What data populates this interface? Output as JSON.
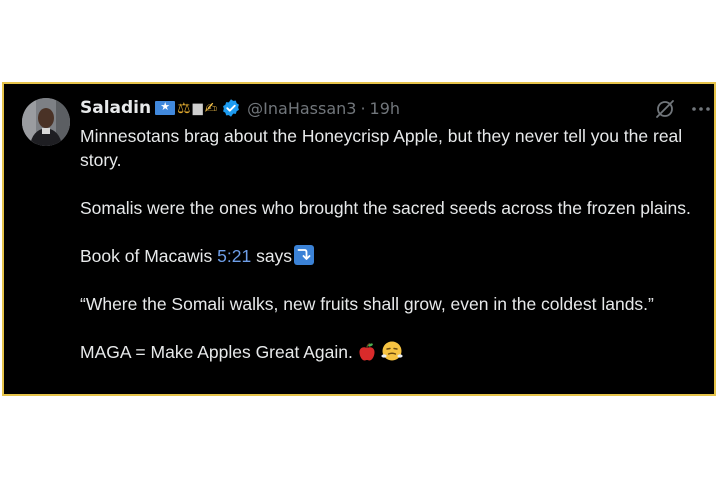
{
  "tweet": {
    "display_name": "Saladin",
    "handle": "@InaHassan3",
    "separator": "·",
    "time": "19h",
    "badges": [
      "somalia-flag",
      "scales",
      "kaaba",
      "writing-hand"
    ],
    "badge_glyphs": {
      "scales": "⚖",
      "kaaba": "▆",
      "writing-hand": "✍"
    },
    "paragraphs": {
      "p1": "Minnesotans brag about the Honeycrisp Apple, but they never tell you the real story.",
      "p2": "Somalis were the ones who brought the sacred seeds across the frozen plains.",
      "p3_before": "Book of Macawis ",
      "p3_link": "5:21",
      "p3_after": " says",
      "p4": "“Where the Somali walks, new fruits shall grow, even in the coldest lands.”",
      "p5": "MAGA = Make Apples Great Again."
    },
    "colors": {
      "background": "#000000",
      "text": "#e7e9ea",
      "muted": "#71767b",
      "link": "#6e9ee8",
      "verified": "#1d9bf0",
      "frame_border": "#e5c34a"
    }
  }
}
